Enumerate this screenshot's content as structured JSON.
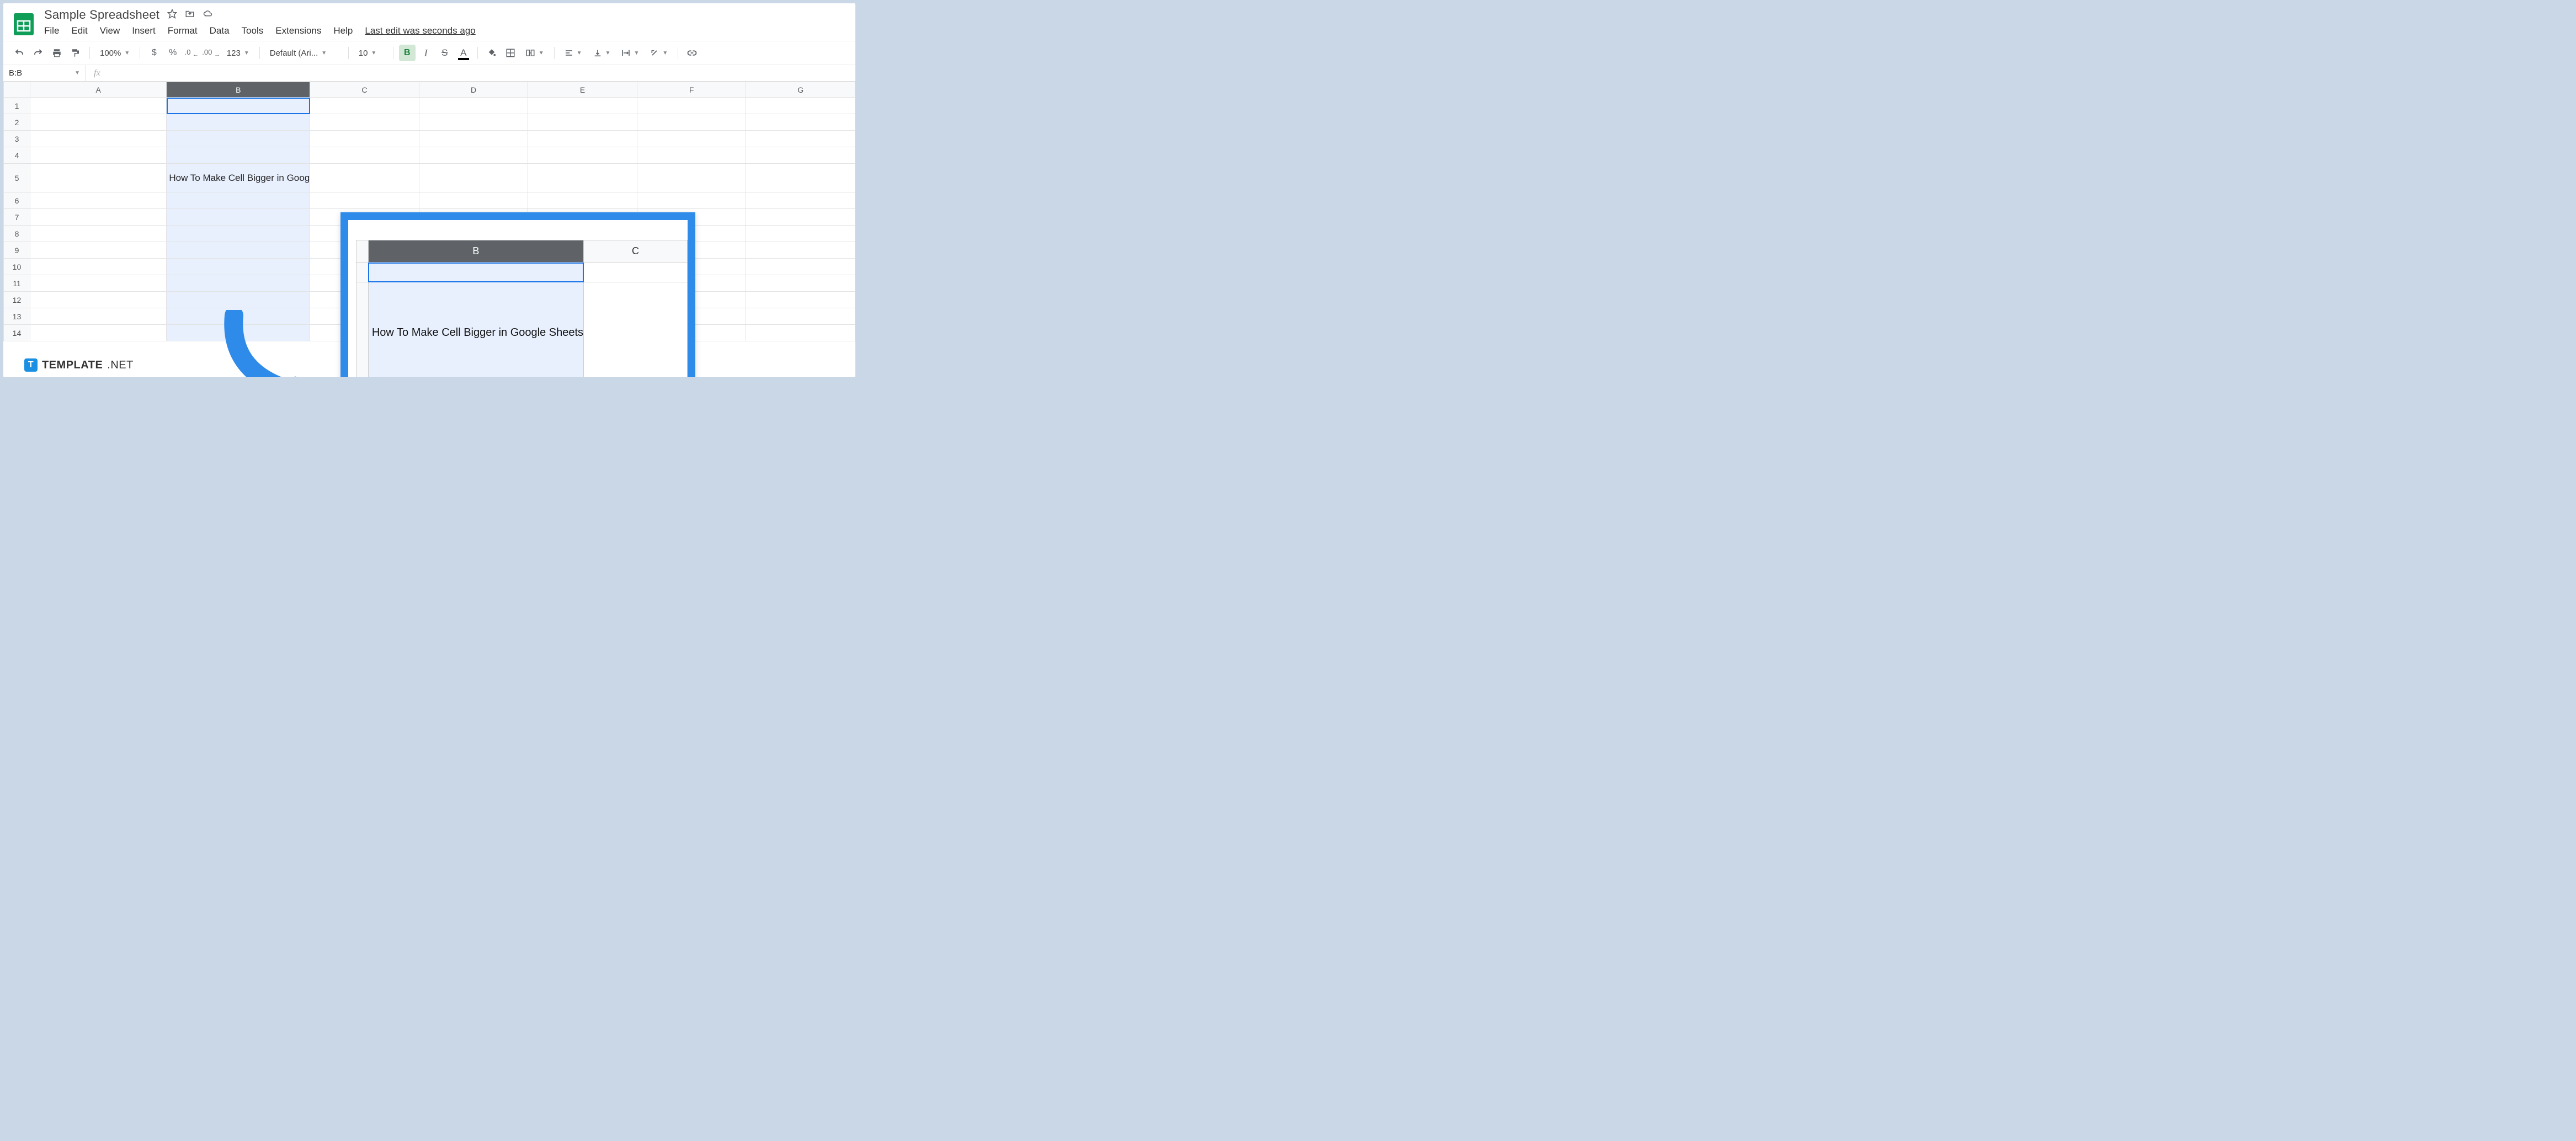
{
  "doc": {
    "title": "Sample Spreadsheet"
  },
  "menu": {
    "file": "File",
    "edit": "Edit",
    "view": "View",
    "insert": "Insert",
    "format": "Format",
    "data": "Data",
    "tools": "Tools",
    "extensions": "Extensions",
    "help": "Help",
    "last_edit": "Last edit was seconds ago"
  },
  "toolbar": {
    "zoom": "100%",
    "currency": "$",
    "percent": "%",
    "dec_dec": ".0",
    "inc_dec": ".00",
    "more_fmt": "123",
    "font": "Default (Ari...",
    "font_size": "10",
    "bold": "B",
    "italic": "I",
    "strike": "S",
    "text_color": "A"
  },
  "namebox": {
    "value": "B:B",
    "fx": "fx"
  },
  "columns": [
    "A",
    "B",
    "C",
    "D",
    "E",
    "F",
    "G"
  ],
  "rows": [
    1,
    2,
    3,
    4,
    5,
    6,
    7,
    8,
    9,
    10,
    11,
    12,
    13,
    14
  ],
  "selected_column": "B",
  "cell_b5": "How To Make Cell Bigger in Goog",
  "overlay": {
    "columns": [
      "B",
      "C"
    ],
    "text": "How To Make Cell Bigger in Google Sheets"
  },
  "watermark": {
    "brand": "TEMPLATE",
    "suffix": ".NET"
  }
}
